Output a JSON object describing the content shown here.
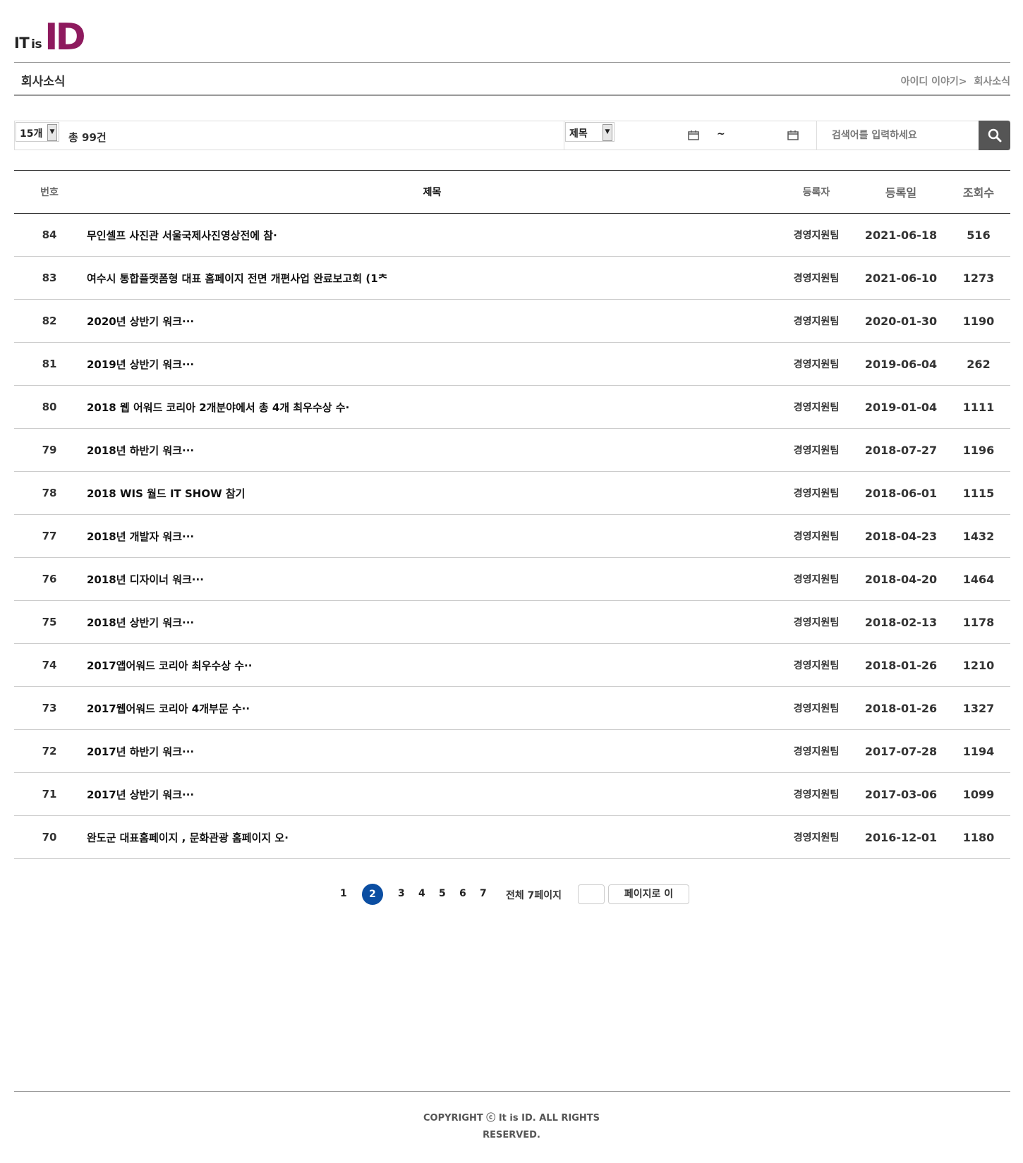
{
  "logo": {
    "small_text": "IT",
    "is_text": "is",
    "big_text": "ID"
  },
  "header": {
    "page_title": "회사소식",
    "breadcrumb": [
      "아이디 이야기>",
      "회사소식"
    ]
  },
  "filter": {
    "page_size": "15개",
    "total": "총 99건",
    "field": "제목",
    "date_separator": "~",
    "search_placeholder": "검색어를 입력하세요"
  },
  "table": {
    "headers": [
      "번호",
      "제목",
      "등록자",
      "등록일",
      "조회수"
    ],
    "rows": [
      {
        "num": "84",
        "title": "무인셀프 사진관 서울국제사진영상전에 참·",
        "writer": "경영지원팀",
        "date": "2021-06-18",
        "views": "516"
      },
      {
        "num": "83",
        "title": "여수시 통합플랫폼형 대표 홈페이지 전면 개편사업 완료보고회 (1ᄎ",
        "writer": "경영지원팀",
        "date": "2021-06-10",
        "views": "1273"
      },
      {
        "num": "82",
        "title": "2020년 상반기 워크···",
        "writer": "경영지원팀",
        "date": "2020-01-30",
        "views": "1190"
      },
      {
        "num": "81",
        "title": "2019년 상반기 워크···",
        "writer": "경영지원팀",
        "date": "2019-06-04",
        "views": "262"
      },
      {
        "num": "80",
        "title": "2018 웹 어워드 코리아 2개분야에서 총 4개 최우수상 수·",
        "writer": "경영지원팀",
        "date": "2019-01-04",
        "views": "1111"
      },
      {
        "num": "79",
        "title": "2018년 하반기 워크···",
        "writer": "경영지원팀",
        "date": "2018-07-27",
        "views": "1196"
      },
      {
        "num": "78",
        "title": "2018 WIS 월드 IT SHOW 참기",
        "writer": "경영지원팀",
        "date": "2018-06-01",
        "views": "1115"
      },
      {
        "num": "77",
        "title": "2018년 개발자 워크···",
        "writer": "경영지원팀",
        "date": "2018-04-23",
        "views": "1432"
      },
      {
        "num": "76",
        "title": "2018년 디자이너 워크···",
        "writer": "경영지원팀",
        "date": "2018-04-20",
        "views": "1464"
      },
      {
        "num": "75",
        "title": "2018년 상반기 워크···",
        "writer": "경영지원팀",
        "date": "2018-02-13",
        "views": "1178"
      },
      {
        "num": "74",
        "title": "2017앱어워드 코리아 최우수상 수··",
        "writer": "경영지원팀",
        "date": "2018-01-26",
        "views": "1210"
      },
      {
        "num": "73",
        "title": "2017웹어워드 코리아 4개부문 수··",
        "writer": "경영지원팀",
        "date": "2018-01-26",
        "views": "1327"
      },
      {
        "num": "72",
        "title": "2017년 하반기 워크···",
        "writer": "경영지원팀",
        "date": "2017-07-28",
        "views": "1194"
      },
      {
        "num": "71",
        "title": "2017년 상반기 워크···",
        "writer": "경영지원팀",
        "date": "2017-03-06",
        "views": "1099"
      },
      {
        "num": "70",
        "title": "완도군 대표홈페이지 , 문화관광 홈페이지 오·",
        "writer": "경영지원팀",
        "date": "2016-12-01",
        "views": "1180"
      }
    ]
  },
  "pagination": {
    "pages": [
      "1",
      "2",
      "3",
      "4",
      "5",
      "6",
      "7"
    ],
    "current": "2",
    "total_pages": "전체 7페이지",
    "go_label": "페이지로 이"
  },
  "footer": {
    "line1": "COPYRIGHT ⓒ It is ID. ALL RIGHTS",
    "line2": "RESERVED."
  },
  "colors": {
    "brand": "#8e1a5e",
    "active_page": "#0b4ea2",
    "search_button": "#555555"
  },
  "icons": {
    "calendar": "calendar-icon",
    "search": "search-icon",
    "dropdown": "chevron-down-icon"
  }
}
